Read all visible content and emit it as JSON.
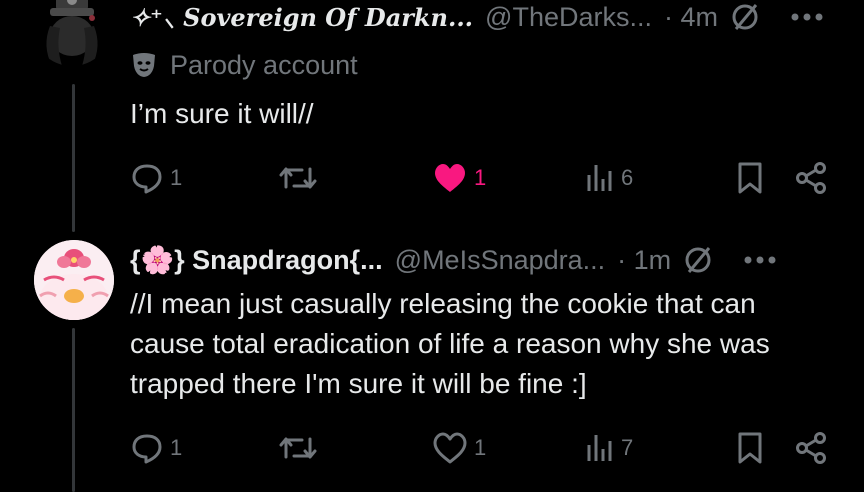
{
  "tweets": [
    {
      "display_name": "✧⁺⸜ Sovereign Of Darkn...",
      "handle": "@TheDarks...",
      "time": "· 4m",
      "label": "Parody account",
      "text": "I’m sure it will//",
      "replies": "1",
      "likes": "1",
      "liked": true,
      "views": "6"
    },
    {
      "display_name": "{🌸} Snapdragon{...",
      "handle": "@MeIsSnapdra...",
      "time": "· 1m",
      "text_lines": [
        "//I mean just casually releasing the cookie that can",
        "cause total eradication of life a reason why she was",
        "trapped there I'm sure it will be fine :]"
      ],
      "replies": "1",
      "likes": "1",
      "liked": false,
      "views": "7"
    }
  ],
  "colors": {
    "background": "#000000",
    "text": "#e7e9ea",
    "muted": "#71767b",
    "like": "#f91880",
    "thread_line": "#333639"
  }
}
